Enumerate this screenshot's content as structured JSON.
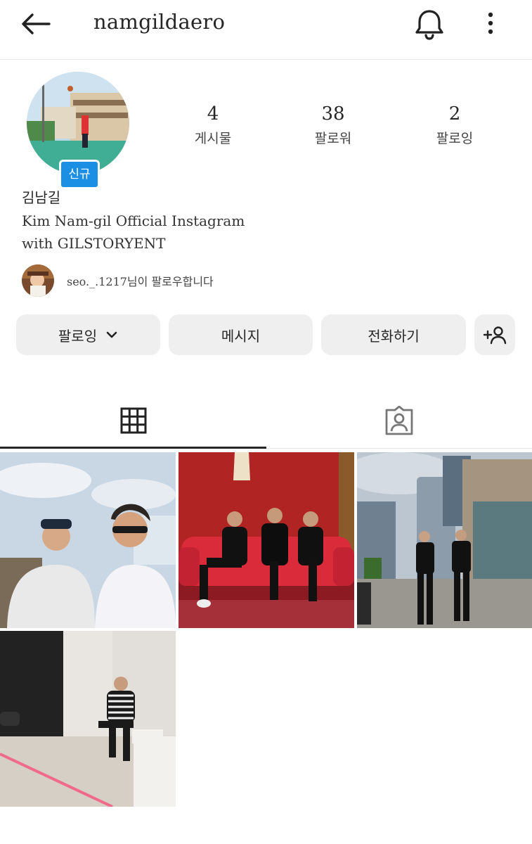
{
  "header": {
    "username": "namgildaero",
    "back_icon": "arrow-left-icon",
    "bell_icon": "bell-icon",
    "more_icon": "more-vertical-icon"
  },
  "profile": {
    "new_badge": "신규",
    "stats": [
      {
        "value": "4",
        "label": "게시물"
      },
      {
        "value": "38",
        "label": "팔로워"
      },
      {
        "value": "2",
        "label": "팔로잉"
      }
    ],
    "name": "김남길",
    "bio_line1": "Kim Nam-gil Official Instagram",
    "bio_line2": "with GILSTORYENT",
    "followed_by": "seo._.1217님이 팔로우합니다"
  },
  "actions": {
    "following": "팔로잉",
    "message": "메시지",
    "call": "전화하기",
    "add_user_icon": "add-user-icon"
  },
  "tabs": [
    {
      "icon": "grid-icon",
      "active": true
    },
    {
      "icon": "tagged-icon",
      "active": false
    }
  ],
  "posts": [
    {
      "subject": "two men selfie at waterfall"
    },
    {
      "subject": "three men on red sofa"
    },
    {
      "subject": "two men in city plaza"
    },
    {
      "subject": "man sitting in white studio"
    }
  ],
  "colors": {
    "badge_blue": "#1a8fe3",
    "button_bg": "#efefef",
    "text": "#262626"
  }
}
